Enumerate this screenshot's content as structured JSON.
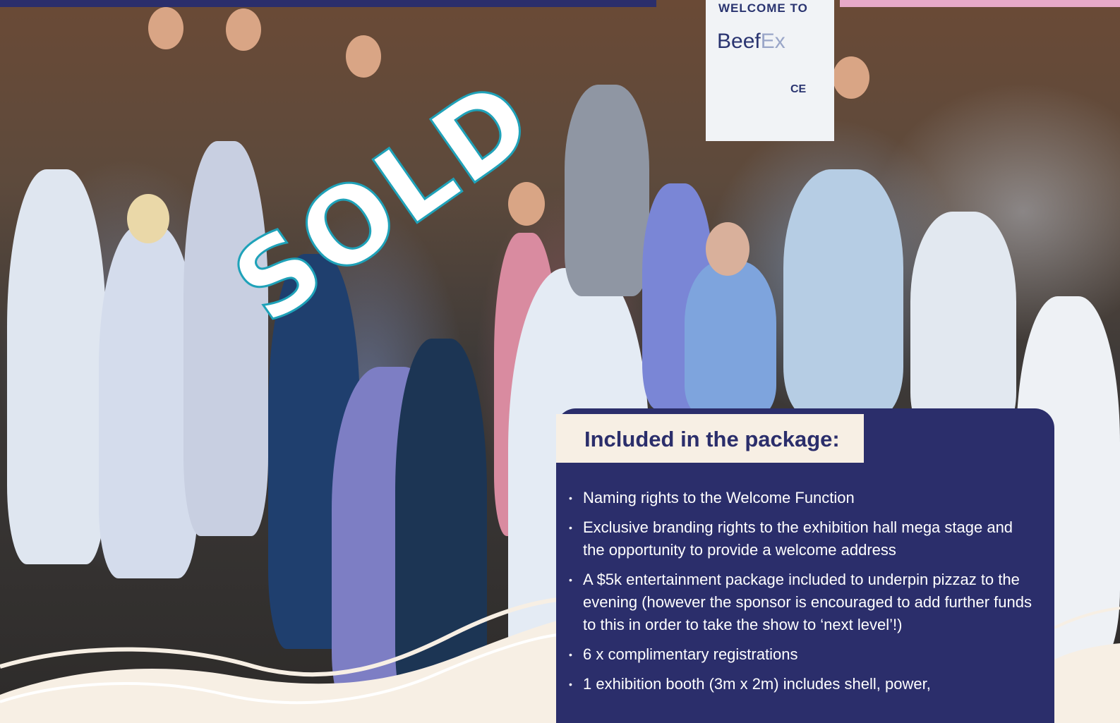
{
  "colors": {
    "navy": "#2b2e6b",
    "cream": "#f7efe4",
    "pink": "#e7a9c8",
    "sold_outline": "#1fa2b9"
  },
  "photo": {
    "sign": {
      "line1": "WELCOME TO",
      "logo_main": "Beef",
      "logo_accent": "Ex",
      "line3": "CE"
    }
  },
  "stamp": "SOLD",
  "package": {
    "title": "Included in the package:",
    "items": [
      "Naming rights to the Welcome Function",
      "Exclusive branding rights to the exhibition hall mega stage and the opportunity to provide a welcome address",
      "A $5k entertainment package included to underpin pizzaz to the evening (however the sponsor is encouraged to add further funds to this in order to take the show to ‘next level’!)",
      "6 x complimentary registrations",
      "1 exhibition booth (3m x 2m) includes shell, power,"
    ]
  }
}
